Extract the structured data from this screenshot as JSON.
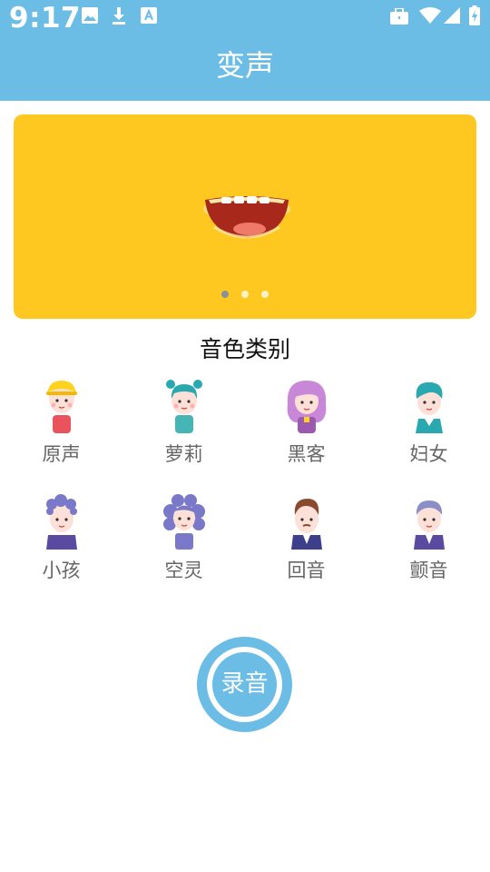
{
  "status_bar": {
    "time": "9:17",
    "left_icons": [
      "image-icon",
      "download-icon",
      "text-a-icon"
    ],
    "right_icons": [
      "briefcase-icon",
      "wifi-icon",
      "signal-icon",
      "battery-charging-icon"
    ]
  },
  "header": {
    "title": "变声"
  },
  "banner": {
    "image": "mouth-illustration",
    "background": "#ffc820",
    "page_count": 3,
    "active_page": 1
  },
  "section": {
    "title": "音色类别"
  },
  "voices": [
    {
      "label": "原声",
      "icon": "boy-yellow-hat-avatar"
    },
    {
      "label": "萝莉",
      "icon": "girl-teal-buns-avatar"
    },
    {
      "label": "黑客",
      "icon": "purple-hair-avatar"
    },
    {
      "label": "妇女",
      "icon": "teal-hair-avatar"
    },
    {
      "label": "小孩",
      "icon": "child-curly-hair-avatar"
    },
    {
      "label": "空灵",
      "icon": "curly-purple-hair-avatar"
    },
    {
      "label": "回音",
      "icon": "man-brown-hair-avatar"
    },
    {
      "label": "颤音",
      "icon": "old-man-avatar"
    }
  ],
  "record": {
    "label": "录音"
  },
  "colors": {
    "accent": "#6bbde6",
    "banner": "#ffc820"
  }
}
